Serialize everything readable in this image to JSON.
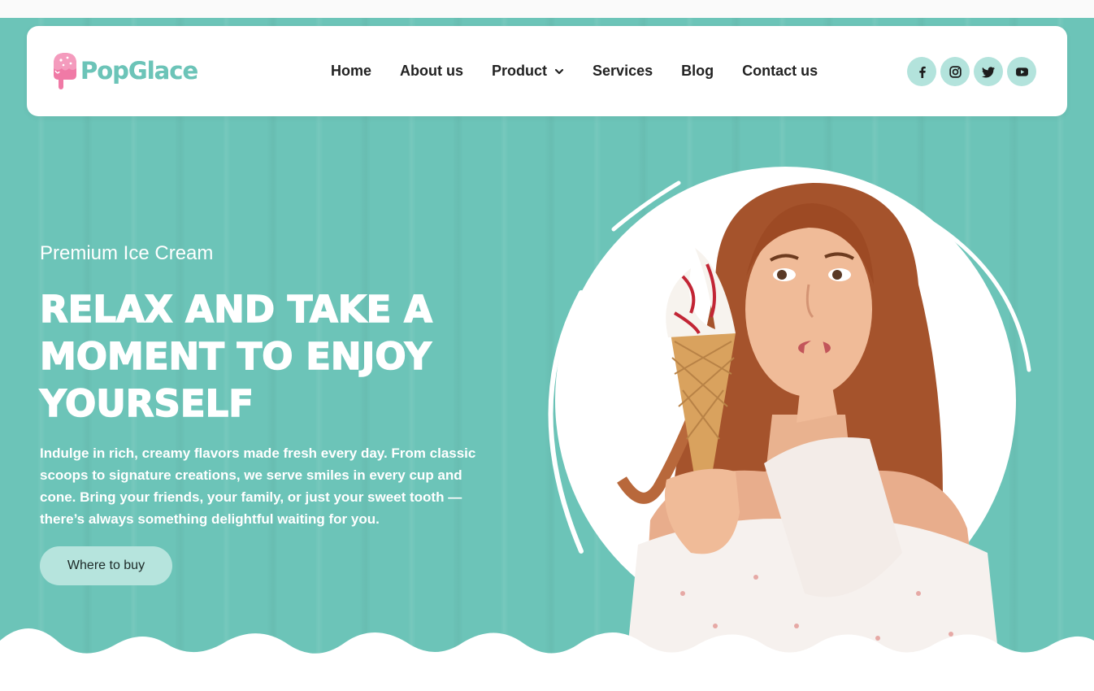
{
  "brand": {
    "name": "PopGlace"
  },
  "nav": {
    "items": [
      {
        "label": "Home"
      },
      {
        "label": "About us"
      },
      {
        "label": "Product"
      },
      {
        "label": "Services"
      },
      {
        "label": "Blog"
      },
      {
        "label": "Contact us"
      }
    ]
  },
  "social": [
    {
      "icon": "facebook-icon"
    },
    {
      "icon": "instagram-icon"
    },
    {
      "icon": "twitter-icon"
    },
    {
      "icon": "youtube-icon"
    }
  ],
  "hero": {
    "eyebrow": "Premium Ice Cream",
    "headline": "RELAX AND TAKE A MOMENT TO ENJOY YOURSELF",
    "description": "Indulge in rich, creamy flavors made fresh every day. From classic scoops to signature creations, we serve smiles in every cup and cone. Bring your friends, your family, or just your sweet tooth — there’s always something delightful waiting for you.",
    "cta_label": "Where to buy"
  },
  "colors": {
    "accent": "#6cc4b8",
    "accent_light": "#b3e3dc",
    "logo_pink": "#f07aa6",
    "text_dark": "#222222"
  }
}
